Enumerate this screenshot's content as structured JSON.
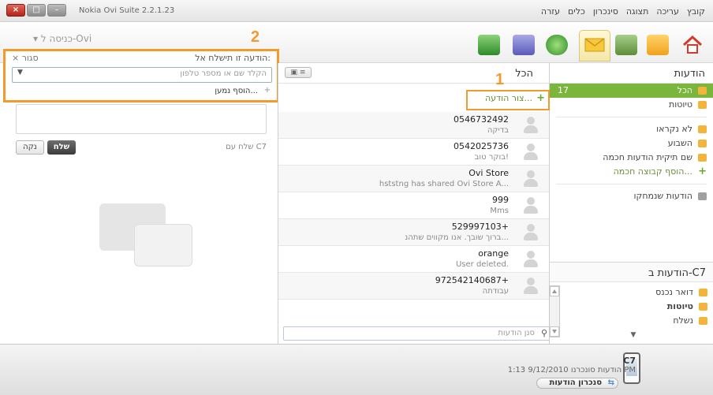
{
  "window": {
    "title": "Nokia Ovi Suite 2.2.1.23",
    "buttons": {
      "close": "×",
      "restore": "□",
      "minimize": "–"
    }
  },
  "menu": [
    "קובץ",
    "עריכה",
    "תצוגה",
    "סינכרון",
    "כלים",
    "עזרה"
  ],
  "toolbar": {
    "ovi_login": "כניסה ל-Ovi",
    "icons": [
      "home-icon",
      "contacts-icon",
      "photos-icon",
      "messages-icon",
      "maps-icon",
      "music-icon",
      "store-icon"
    ],
    "active": "messages-icon"
  },
  "sidebar": {
    "header": "הודעות",
    "items": [
      {
        "label": "הכל",
        "count": "17",
        "selected": true
      },
      {
        "label": "טיוטות"
      },
      {
        "label": "לא נקראו"
      },
      {
        "label": "השבוע"
      },
      {
        "label": "שם תיקית הודעות חכמה"
      },
      {
        "label": "הוסף קבוצה חכמה..."
      },
      {
        "label": "הודעות שנמחקו"
      }
    ],
    "device_header": "הודעות ב-C7",
    "device_items": [
      {
        "label": "דואר נכנס"
      },
      {
        "label": "טיוטות"
      },
      {
        "label": "נשלח"
      }
    ]
  },
  "message_list": {
    "header": "הכל",
    "compose_label": "צור הודעה...",
    "filter_placeholder": "סנן הודעות",
    "rows": [
      {
        "from": "0546732492",
        "preview": "בדיקה"
      },
      {
        "from": "0542025736",
        "preview": "בוקר טוב!"
      },
      {
        "from": "Ovi Store",
        "preview": "hststng has shared Ovi Store A..."
      },
      {
        "from": "999",
        "preview": "Mms"
      },
      {
        "from": "529997103+",
        "preview": "ברוך שובך. אנו מקווים שתהנ..."
      },
      {
        "from": "orange",
        "preview": "User deleted."
      },
      {
        "from": "972542140687+",
        "preview": "עבודתה"
      }
    ]
  },
  "compose": {
    "send_to_label": "הודעה זו תישלח אל:",
    "close_label": "סגור",
    "recipient_placeholder": "הקלד שם או מספר טלפון",
    "add_recipient_label": "הוסף נמען...",
    "send_with": "שלח עם C7",
    "send_button": "שלח",
    "clear_button": "נקה"
  },
  "annotations": {
    "one": "1",
    "two": "2",
    "color": "#f29a2e"
  },
  "status": {
    "device": "C7",
    "sync_info": "הודעות סונכרנו 9/12/2010 1:13 PM",
    "sync_button": "סנכרון הודעות"
  },
  "colors": {
    "accent_green": "#7ab63b",
    "highlight_orange": "#f29a2e"
  }
}
